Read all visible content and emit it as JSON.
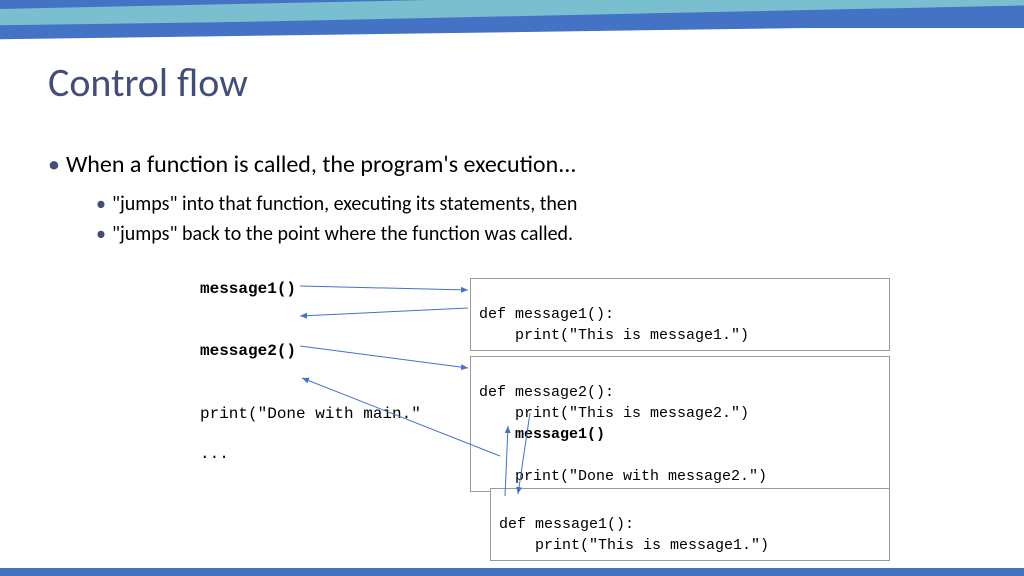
{
  "title": "Control flow",
  "bullets": {
    "main": "When a function is called, the program's execution...",
    "sub1": "\"jumps\" into that function, executing its statements, then",
    "sub2": "\"jumps\" back to the point where the function was called."
  },
  "left_code": {
    "l1": "message1()",
    "l2": "message2()",
    "l3": "print(\"Done with main.\"",
    "l4": "..."
  },
  "box1": {
    "l1": "def message1():",
    "l2": "    print(\"This is message1.\")"
  },
  "box2": {
    "l1": "def message2():",
    "l2": "    print(\"This is message2.\")",
    "l3": "    message1()",
    "l4": "",
    "l5": "    print(\"Done with message2.\")"
  },
  "box3": {
    "l1": "def message1():",
    "l2": "    print(\"This is message1.\")"
  }
}
